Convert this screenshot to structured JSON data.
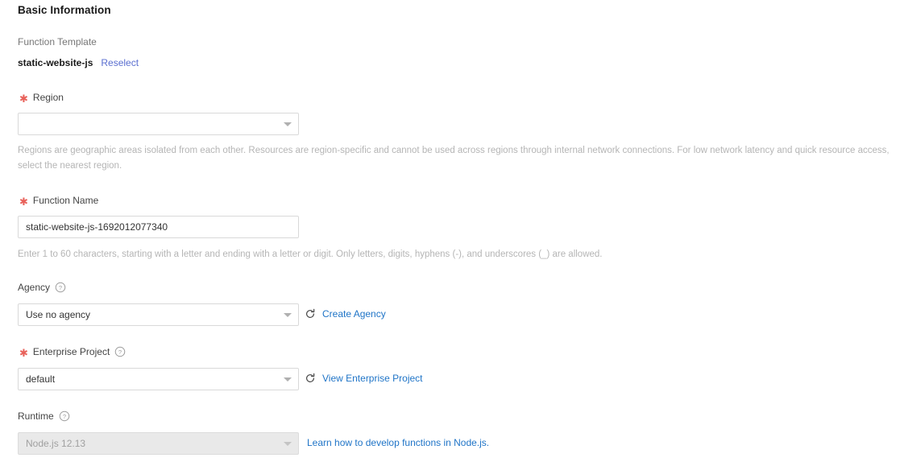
{
  "section": {
    "title": "Basic Information"
  },
  "template": {
    "label": "Function Template",
    "name": "static-website-js",
    "reselect_label": "Reselect"
  },
  "region": {
    "label": "Region",
    "required": true,
    "value": "",
    "hint": "Regions are geographic areas isolated from each other. Resources are region-specific and cannot be used across regions through internal network connections. For low network latency and quick resource access, select the nearest region."
  },
  "function_name": {
    "label": "Function Name",
    "required": true,
    "value": "static-website-js-1692012077340",
    "hint": "Enter 1 to 60 characters, starting with a letter and ending with a letter or digit. Only letters, digits, hyphens (-), and underscores (_) are allowed."
  },
  "agency": {
    "label": "Agency",
    "required": false,
    "value": "Use no agency",
    "action_label": "Create Agency"
  },
  "enterprise_project": {
    "label": "Enterprise Project",
    "required": true,
    "value": "default",
    "action_label": "View Enterprise Project"
  },
  "runtime": {
    "label": "Runtime",
    "required": false,
    "value": "Node.js 12.13",
    "disabled": true,
    "action_label": "Learn how to develop functions in Node.js."
  },
  "icons": {
    "help": "help-circle-icon",
    "refresh": "refresh-icon",
    "caret": "chevron-down-icon"
  },
  "colors": {
    "link": "#1f74c7",
    "link_visited": "#5b6fd0",
    "required_star": "#e8615a",
    "hint_text": "#b5b5b5"
  }
}
